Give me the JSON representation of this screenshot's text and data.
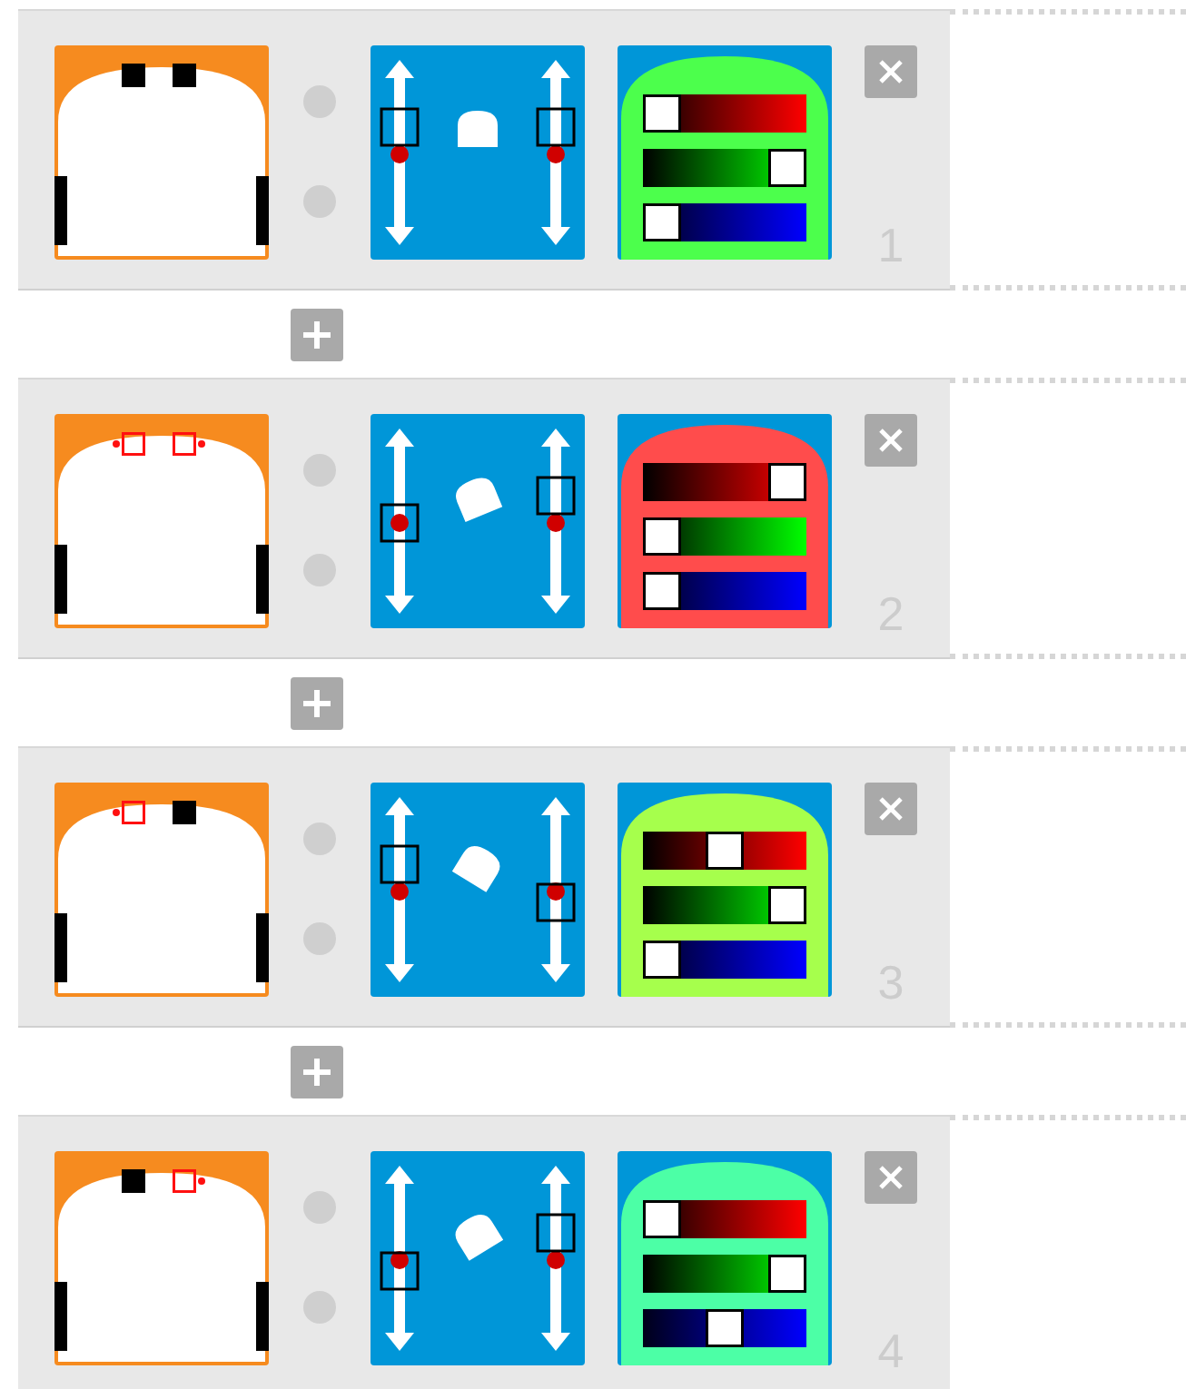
{
  "rules": [
    {
      "number": "1",
      "sensors": [
        {
          "detected": false
        },
        {
          "detected": false
        }
      ],
      "motors": [
        {
          "level": 0.65
        },
        {
          "level": 0.65
        }
      ],
      "color_sliders": [
        {
          "kind": "red",
          "level": 0
        },
        {
          "kind": "green",
          "level": 1
        },
        {
          "kind": "blue",
          "level": 0
        }
      ]
    },
    {
      "number": "2",
      "sensors": [
        {
          "detected": true
        },
        {
          "detected": true
        }
      ],
      "motors": [
        {
          "level": 0.5
        },
        {
          "level": 0.65
        }
      ],
      "color_sliders": [
        {
          "kind": "red",
          "level": 1
        },
        {
          "kind": "green",
          "level": 0
        },
        {
          "kind": "blue",
          "level": 0
        }
      ]
    },
    {
      "number": "3",
      "sensors": [
        {
          "detected": true
        },
        {
          "detected": false
        }
      ],
      "motors": [
        {
          "level": 0.65
        },
        {
          "level": 0.44
        }
      ],
      "color_sliders": [
        {
          "kind": "red",
          "level": 0.5
        },
        {
          "kind": "green",
          "level": 1
        },
        {
          "kind": "blue",
          "level": 0
        }
      ]
    },
    {
      "number": "4",
      "sensors": [
        {
          "detected": false
        },
        {
          "detected": true
        }
      ],
      "motors": [
        {
          "level": 0.44
        },
        {
          "level": 0.65
        }
      ],
      "color_sliders": [
        {
          "kind": "red",
          "level": 0
        },
        {
          "kind": "green",
          "level": 1
        },
        {
          "kind": "blue",
          "level": 0.5
        }
      ]
    }
  ]
}
